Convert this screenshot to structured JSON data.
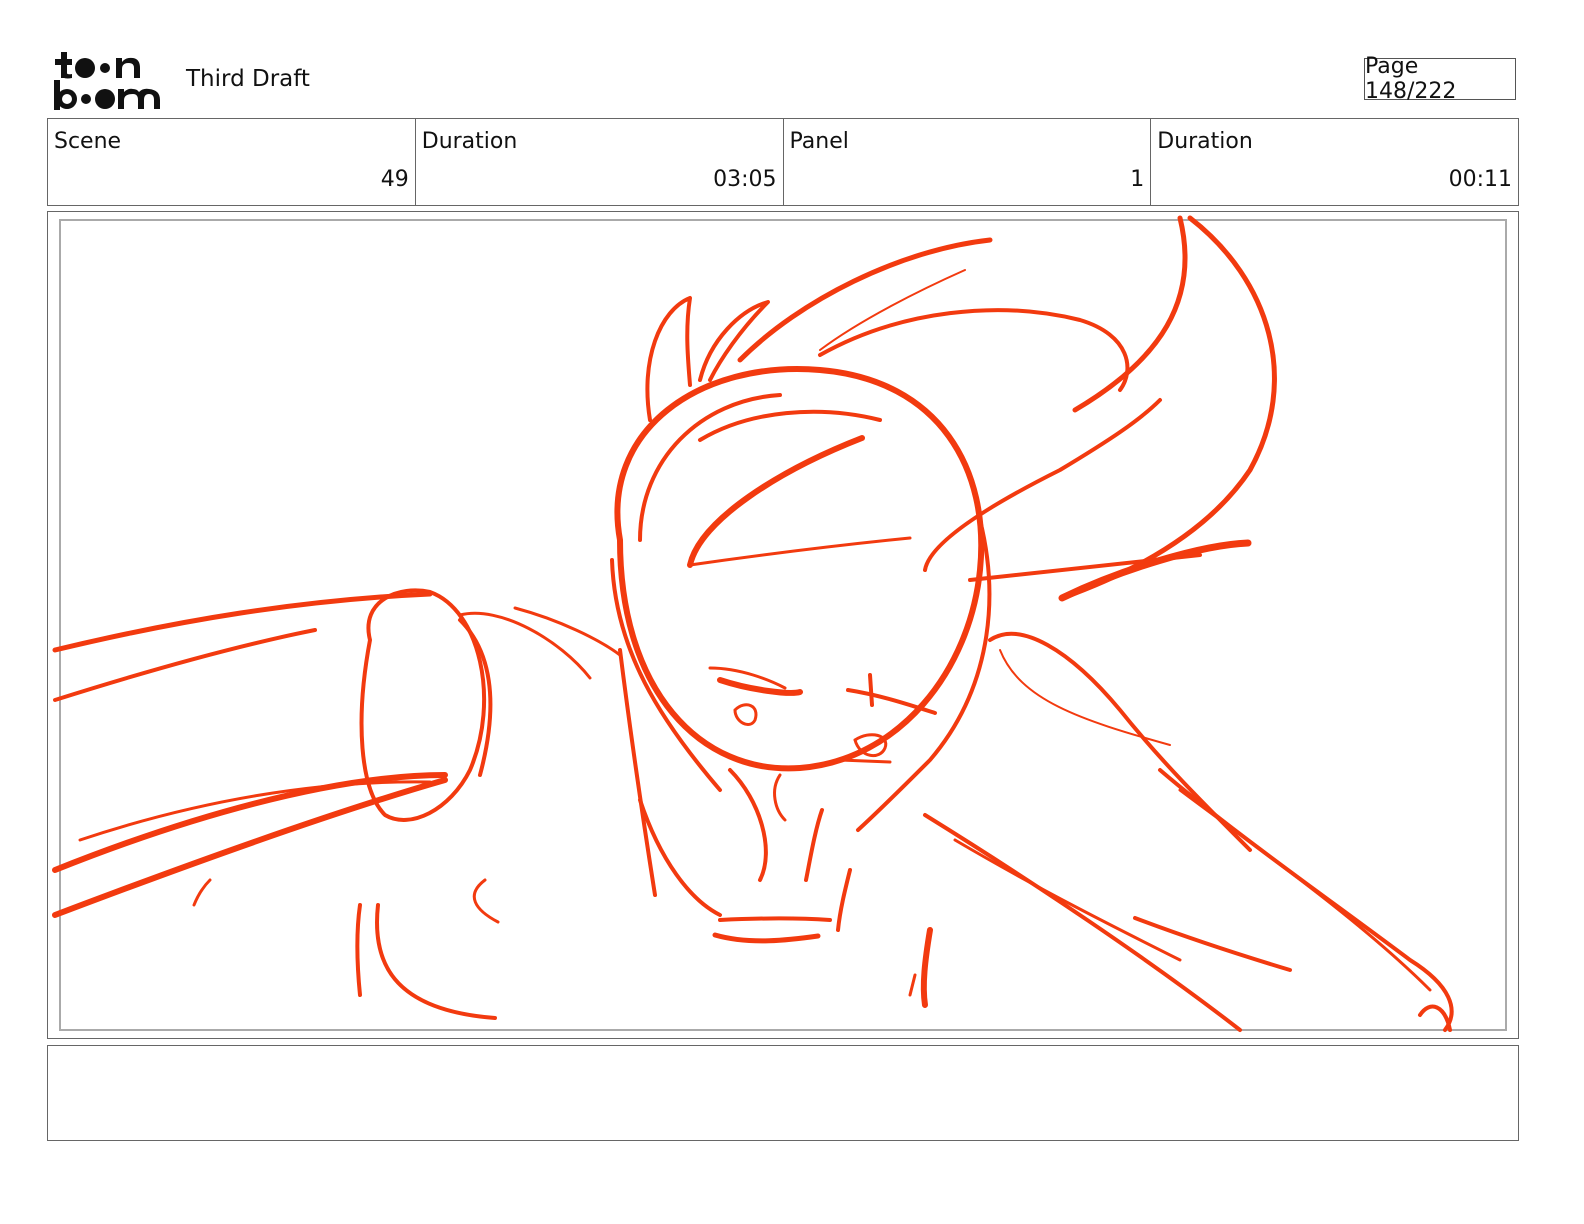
{
  "header": {
    "logo_text_top": "toon",
    "logo_text_bottom": "boom",
    "draft_title": "Third Draft",
    "page_label": "Page 148/222"
  },
  "info": {
    "scene_label": "Scene",
    "scene_value": "49",
    "scene_duration_label": "Duration",
    "scene_duration_value": "03:05",
    "panel_label": "Panel",
    "panel_value": "1",
    "panel_duration_label": "Duration",
    "panel_duration_value": "00:11"
  },
  "sketch": {
    "stroke_color": "#f23a0f"
  },
  "notes": {
    "text": ""
  }
}
